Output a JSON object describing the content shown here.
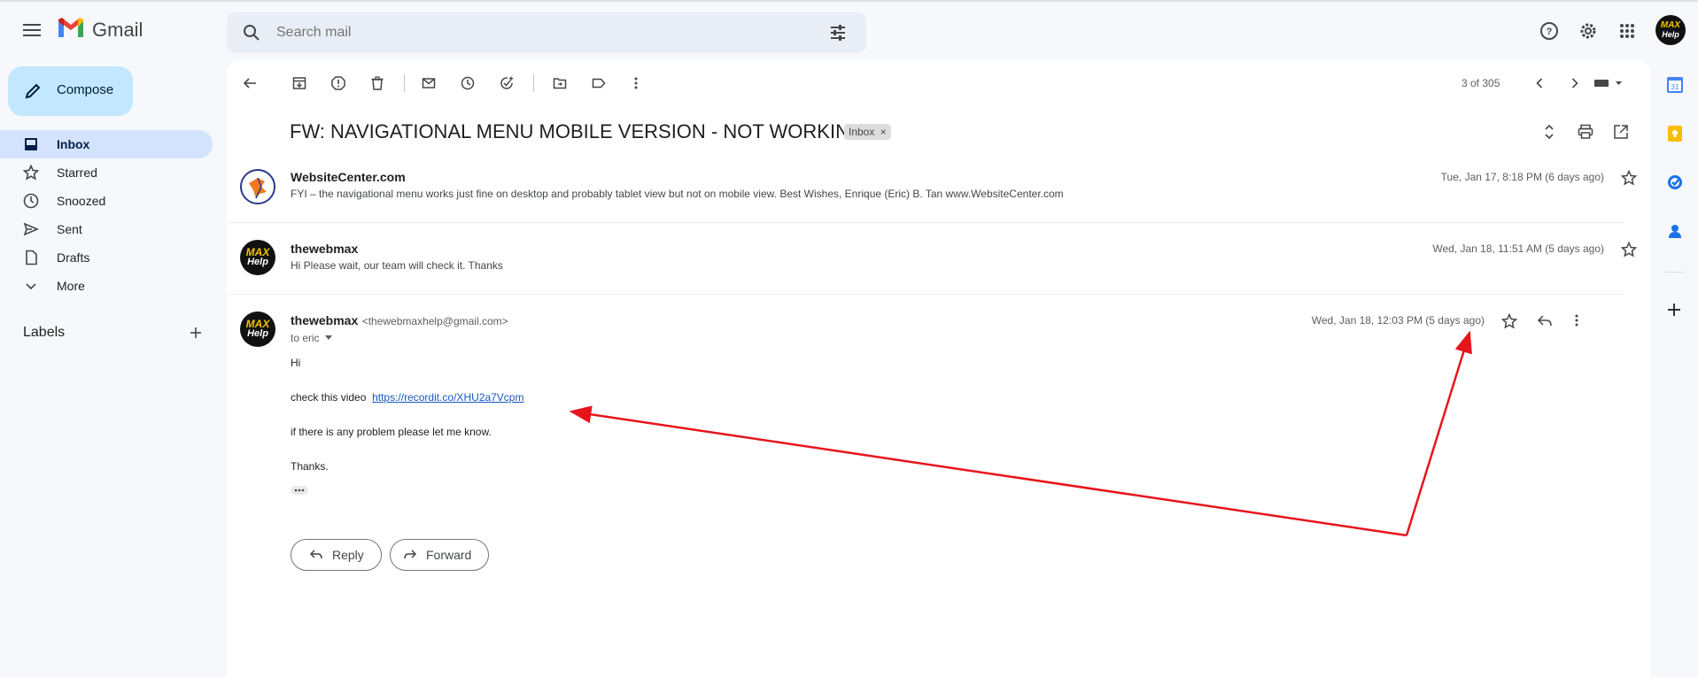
{
  "app": {
    "brand": "Gmail"
  },
  "search": {
    "placeholder": "Search mail"
  },
  "compose": {
    "label": "Compose"
  },
  "sidebar": {
    "items": [
      {
        "label": "Inbox",
        "icon": "inbox-icon",
        "active": true
      },
      {
        "label": "Starred",
        "icon": "star-icon"
      },
      {
        "label": "Snoozed",
        "icon": "clock-icon"
      },
      {
        "label": "Sent",
        "icon": "send-icon"
      },
      {
        "label": "Drafts",
        "icon": "draft-icon"
      },
      {
        "label": "More",
        "icon": "chevron-down-icon"
      }
    ],
    "labels_title": "Labels"
  },
  "toolbar": {
    "pager": "3 of 305"
  },
  "thread": {
    "subject": "FW: NAVIGATIONAL MENU MOBILE VERSION - NOT WORKING",
    "badge": "Inbox",
    "messages": [
      {
        "sender": "WebsiteCenter.com",
        "snippet": "FYI – the navigational menu works just fine on desktop and probably tablet view but not on mobile view. Best Wishes, Enrique (Eric) B. Tan www.WebsiteCenter.com",
        "date": "Tue, Jan 17, 8:18 PM (6 days ago)"
      },
      {
        "sender": "thewebmax",
        "snippet": "Hi Please wait, our team will check it. Thanks",
        "date": "Wed, Jan 18, 11:51 AM (5 days ago)"
      },
      {
        "sender": "thewebmax",
        "email": "<thewebmaxhelp@gmail.com>",
        "to": "to eric",
        "date": "Wed, Jan 18, 12:03 PM (5 days ago)",
        "body": {
          "greeting": "Hi",
          "line1_prefix": "check this video",
          "link": "https://recordit.co/XHU2a7Vcpm",
          "line2": "if there is any problem please let me know.",
          "closing": "Thanks."
        }
      }
    ],
    "reply_label": "Reply",
    "forward_label": "Forward"
  },
  "avatar_text": {
    "line1": "MAX",
    "line2": "Help"
  },
  "colors": {
    "accent": "#c2e7ff",
    "active_nav": "#d3e3fd",
    "annotation": "#e8141b",
    "link": "#1a56c4"
  }
}
